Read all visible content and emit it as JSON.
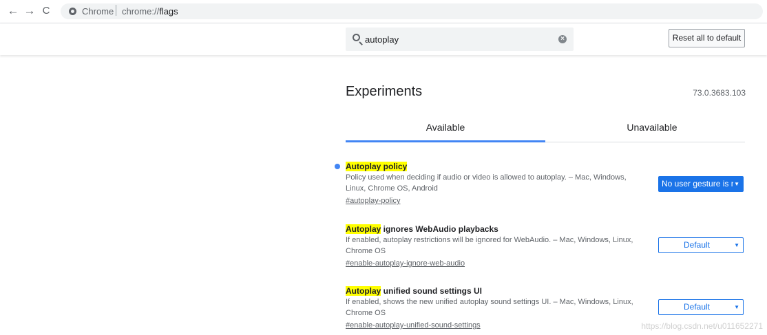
{
  "browser": {
    "back_glyph": "←",
    "forward_glyph": "→",
    "reload_glyph": "C",
    "omnibox_origin": "Chrome",
    "omnibox_url_scheme": "chrome://",
    "omnibox_url_path": "flags"
  },
  "search": {
    "value": "autoplay",
    "clear_glyph": "×"
  },
  "reset_button_label": "Reset all to default",
  "page": {
    "title": "Experiments",
    "version": "73.0.3683.103"
  },
  "tabs": [
    {
      "label": "Available",
      "active": true
    },
    {
      "label": "Unavailable",
      "active": false
    }
  ],
  "experiments": [
    {
      "title_highlight": "Autoplay policy",
      "title_rest": "",
      "description": "Policy used when deciding if audio or video is allowed to autoplay. – Mac, Windows, Linux, Chrome OS, Android",
      "link": "#autoplay-policy",
      "selected": "No user gesture is required",
      "modified": true
    },
    {
      "title_highlight": "Autoplay",
      "title_rest": " ignores WebAudio playbacks",
      "description": "If enabled, autoplay restrictions will be ignored for WebAudio. – Mac, Windows, Linux, Chrome OS",
      "link": "#enable-autoplay-ignore-web-audio",
      "selected": "Default",
      "modified": false
    },
    {
      "title_highlight": "Autoplay",
      "title_rest": " unified sound settings UI",
      "description": "If enabled, shows the new unified autoplay sound settings UI. – Mac, Windows, Linux, Chrome OS",
      "link": "#enable-autoplay-unified-sound-settings",
      "selected": "Default",
      "modified": false
    }
  ],
  "select_arrow_glyph": "▼",
  "watermark": "https://blog.csdn.net/u011652271",
  "colors": {
    "accent": "#1a73e8",
    "tab_indicator": "#4285f4",
    "highlight": "#ffff00"
  }
}
